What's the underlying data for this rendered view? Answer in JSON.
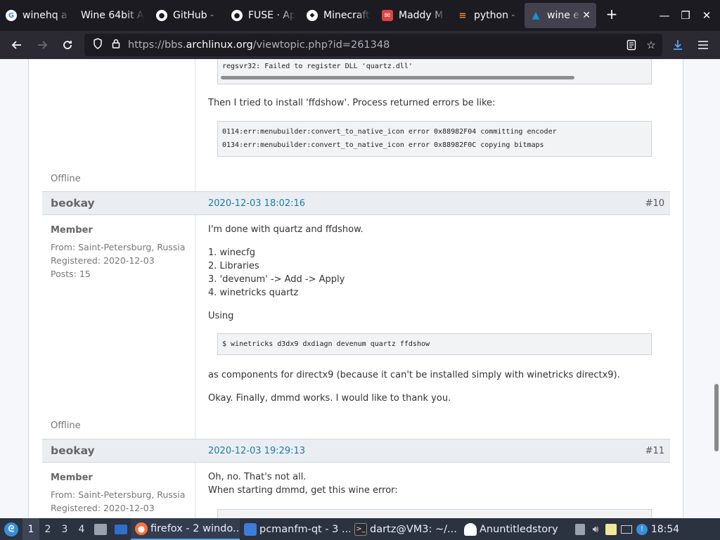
{
  "tabs": [
    {
      "title": "winehq a",
      "icon": "google-icon",
      "color": "#ffffff"
    },
    {
      "title": "Wine 64bit A",
      "icon": "none",
      "color": ""
    },
    {
      "title": "GitHub -",
      "icon": "github-icon",
      "color": "#ffffff"
    },
    {
      "title": "FUSE · Ap",
      "icon": "github-icon",
      "color": "#ffffff"
    },
    {
      "title": "Minecraft",
      "icon": "minecraft-icon",
      "color": "#ffffff"
    },
    {
      "title": "Maddy M",
      "icon": "maddy-icon",
      "color": "#e04343"
    },
    {
      "title": "python -",
      "icon": "stackoverflow-icon",
      "color": "#f48024"
    },
    {
      "title": "wine er",
      "icon": "archlinux-icon",
      "color": "#1793d1"
    }
  ],
  "toolbar": {
    "url_prefix": "https://bbs.",
    "url_host": "archlinux.org",
    "url_path": "/viewtopic.php?id=261348"
  },
  "posts": {
    "prev": {
      "code_top": "regsvr32: Failed to register DLL 'quartz.dll'",
      "text1": "Then I tried to install 'ffdshow'. Process returned errors be like:",
      "code_lines": [
        "0114:err:menubuilder:convert_to_native_icon error 0x88982F04 committing encoder",
        "0134:err:menubuilder:convert_to_native_icon error 0x88982F0C copying bitmaps"
      ],
      "status": "Offline"
    },
    "p10": {
      "author": "beokay",
      "date": "2020-12-03 18:02:16",
      "num": "#10",
      "role": "Member",
      "from": "From: Saint-Petersburg, Russia",
      "registered": "Registered: 2020-12-03",
      "posts": "Posts: 15",
      "intro": "I'm done with quartz and ffdshow.",
      "steps": [
        "1. winecfg",
        "2. Libraries",
        "3. 'devenum' -> Add -> Apply",
        "4. winetricks quartz"
      ],
      "using": "Using",
      "code": "$ winetricks d3dx9 dxdiagn devenum quartz ffdshow",
      "after": "as components for directx9 (because it can't be installed simply with winetricks directx9).",
      "final": "Okay. Finally, dmmd works. I would like to thank you.",
      "status": "Offline"
    },
    "p11": {
      "author": "beokay",
      "date": "2020-12-03 19:29:13",
      "num": "#11",
      "role": "Member",
      "from": "From: Saint-Petersburg, Russia",
      "registered": "Registered: 2020-12-03",
      "line1": "Oh, no. That's not all.",
      "line2": "When starting dmmd, get this wine error:"
    }
  },
  "taskbar": {
    "workspaces": [
      "1",
      "2",
      "3",
      "4"
    ],
    "tasks": [
      {
        "label": "firefox - 2 windo...",
        "icon": "firefox-icon",
        "color": "#ff7139"
      },
      {
        "label": "pcmanfm-qt - 3 ...",
        "icon": "folder-icon",
        "color": "#3b7dd8"
      },
      {
        "label": "dartz@VM3: ~/...",
        "icon": "terminal-icon",
        "color": "#2b2b2b"
      },
      {
        "label": "Anuntitledstory",
        "icon": "ghost-icon",
        "color": "#ffffff"
      }
    ],
    "clock": "18:54"
  }
}
